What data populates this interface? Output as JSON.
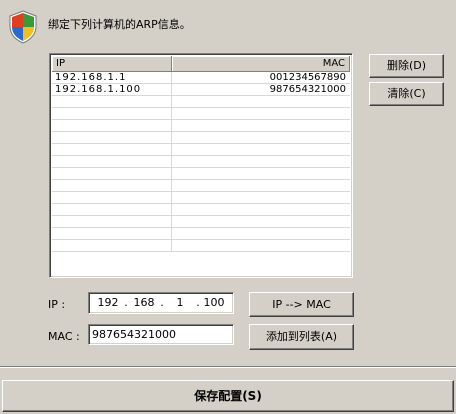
{
  "header": {
    "icon": "shield-icon",
    "text": "绑定下列计算机的ARP信息。"
  },
  "table": {
    "columns": [
      "IP",
      "MAC"
    ],
    "rows": [
      {
        "ip": "192.168.1.1",
        "mac": "001234567890"
      },
      {
        "ip": "192.168.1.100",
        "mac": "987654321000"
      }
    ]
  },
  "buttons": {
    "delete": "删除(D)",
    "clear": "清除(C)",
    "ip_to_mac": "IP --> MAC",
    "add_to_list": "添加到列表(A)",
    "save": "保存配置(S)"
  },
  "form": {
    "ip_label": "IP :",
    "ip_octets": [
      "192",
      "168",
      "1",
      "100"
    ],
    "mac_label": "MAC :",
    "mac_value": "987654321000"
  }
}
